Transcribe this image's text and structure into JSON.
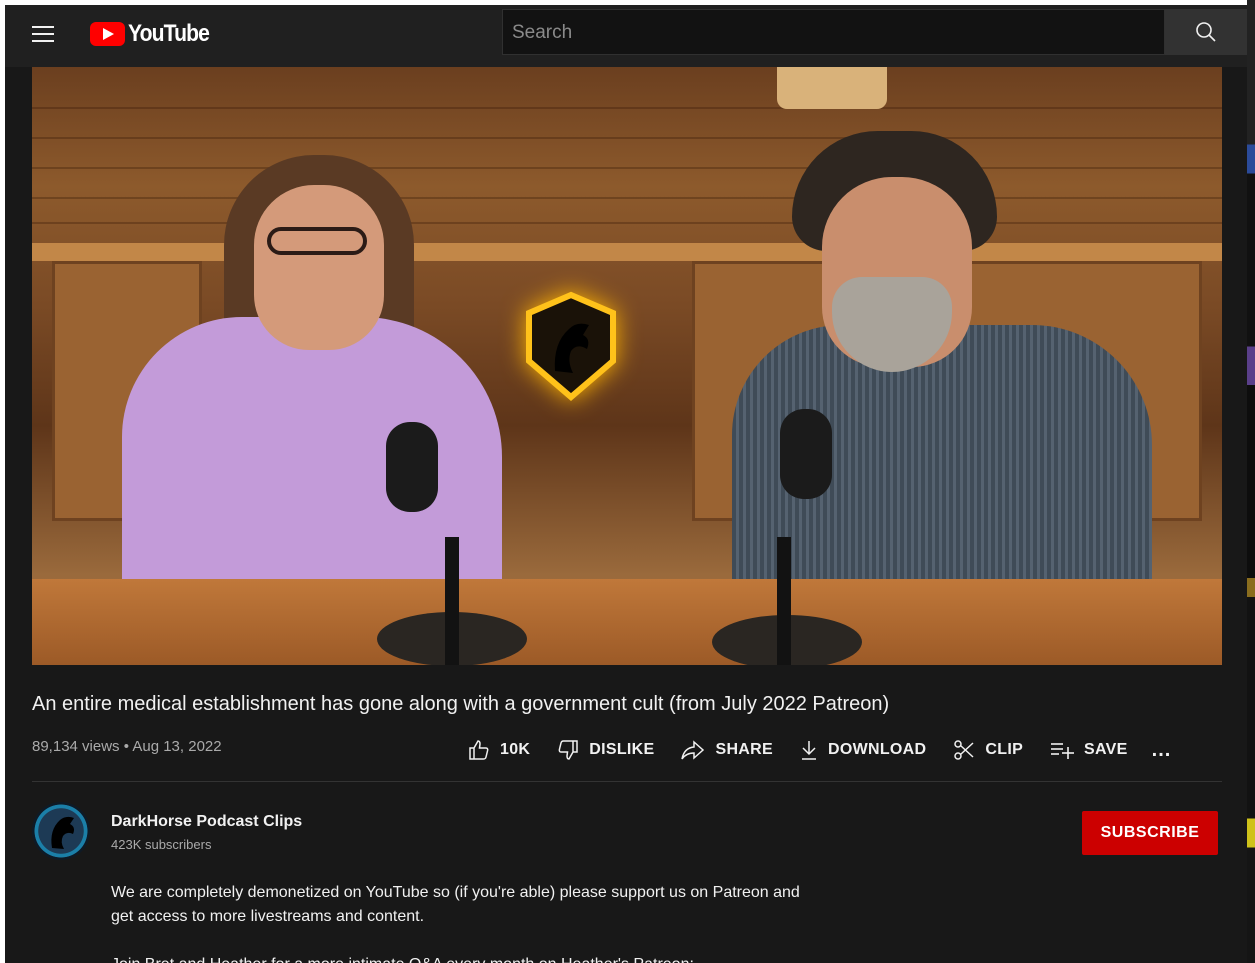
{
  "header": {
    "logo_text": "YouTube",
    "search_placeholder": "Search"
  },
  "video": {
    "title": "An entire medical establishment has gone along with a government cult (from July 2022 Patreon)",
    "views": "89,134 views",
    "date": "Aug 13, 2022",
    "meta_separator": "•"
  },
  "actions": {
    "like_count": "10K",
    "dislike_label": "DISLIKE",
    "share_label": "SHARE",
    "download_label": "DOWNLOAD",
    "clip_label": "CLIP",
    "save_label": "SAVE",
    "more_label": "..."
  },
  "channel": {
    "name": "DarkHorse Podcast Clips",
    "subscribers": "423K subscribers",
    "subscribe_label": "SUBSCRIBE",
    "colors": {
      "subscribe": "#cc0000"
    }
  },
  "description": {
    "line1": "We are completely demonetized on YouTube so (if you're able) please support us on Patreon and",
    "line2": "get access to more livestreams and content.",
    "line3": "Join Bret and Heather for a more intimate Q&A every month on Heather's Patreon:"
  }
}
